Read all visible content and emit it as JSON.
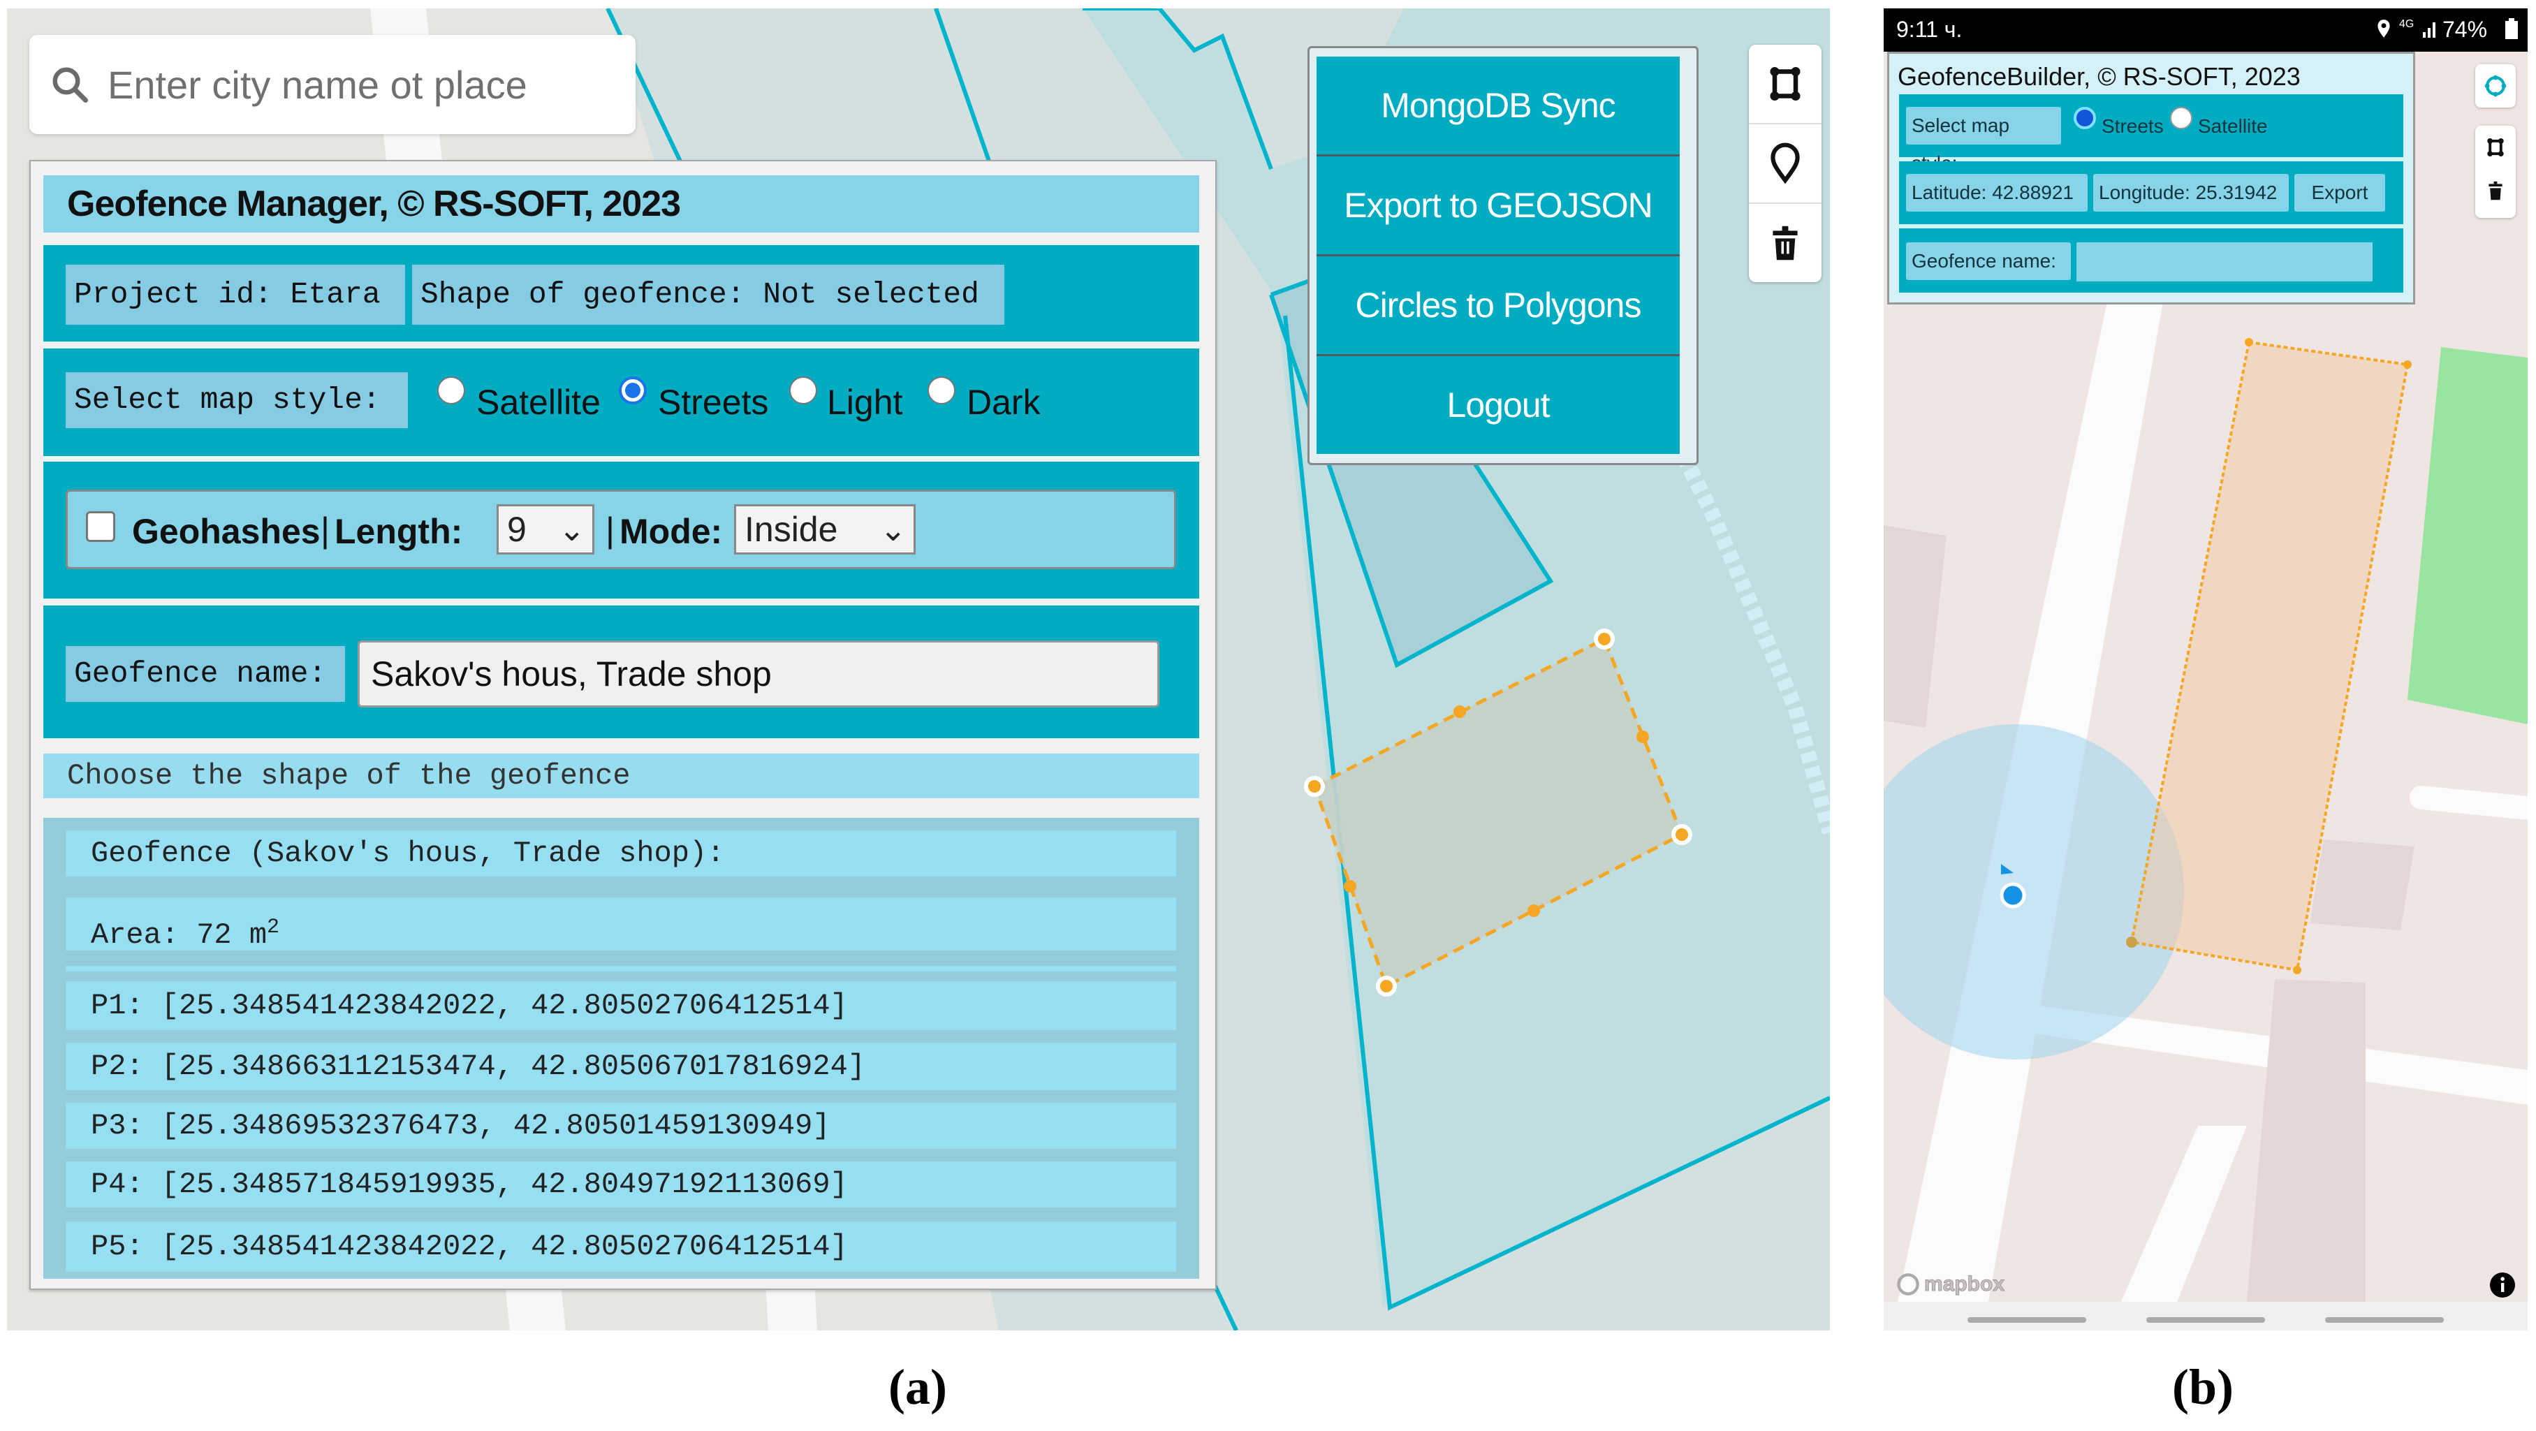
{
  "panel_a": {
    "search": {
      "placeholder": "Enter city name ot place",
      "icon": "search-icon"
    },
    "manager": {
      "title_prefix": "Geofence Manager, © ",
      "title_brand": "RS-SOFT, 2023",
      "project_label": "Project id: Etara",
      "shape_label": "Shape of geofence: Not selected",
      "map_style_label": "Select map style:",
      "map_styles": [
        {
          "label": "Satellite",
          "selected": false
        },
        {
          "label": "Streets",
          "selected": true
        },
        {
          "label": "Light",
          "selected": false
        },
        {
          "label": "Dark",
          "selected": false
        }
      ],
      "geohashes": {
        "checked": false,
        "label": "Geohashes",
        "sep1": "|",
        "length_label": "Length:",
        "length_value": "9",
        "sep2": "|",
        "mode_label": "Mode:",
        "mode_value": "Inside"
      },
      "geofence_name_label": "Geofence name:",
      "geofence_name_value": "Sakov's hous, Trade shop",
      "choose_shape_hint": "Choose the shape of the geofence",
      "result": {
        "heading": "Geofence (Sakov's hous, Trade shop):",
        "area_prefix": "Area: 72 m",
        "area_superscript": "2",
        "points": [
          "P1: [25.348541423842022, 42.80502706412514]",
          "P2: [25.348663112153474, 42.805067017816924]",
          "P3: [25.34869532376473, 42.80501459130949]",
          "P4: [25.348571845919935, 42.80497192113069]",
          "P5: [25.348541423842022, 42.80502706412514]"
        ]
      }
    },
    "menu": {
      "buttons": [
        "MongoDB Sync",
        "Export to GEOJSON",
        "Circles to Polygons",
        "Logout"
      ]
    },
    "draw_tools": [
      "polygon-tool-icon",
      "marker-tool-icon",
      "trash-icon"
    ],
    "colors": {
      "accent": "#00acc1",
      "label_bg": "#87d3e8",
      "geofence_stroke": "#f5a623"
    }
  },
  "panel_b": {
    "status_bar": {
      "time": "9:11 ч.",
      "network": "4G",
      "battery": "74%"
    },
    "app_title": "GeofenceBuilder, © RS-SOFT, 2023",
    "map_style_label": "Select map style:",
    "map_styles": [
      {
        "label": "Streets",
        "selected": true
      },
      {
        "label": "Satellite",
        "selected": false
      }
    ],
    "latitude_label": "Latitude: 42.88921",
    "longitude_label": "Longitude: 25.31942",
    "export_label": "Export",
    "geofence_name_label": "Geofence name:",
    "geofence_name_value": "",
    "map_attribution": "mapbox",
    "draw_tools": [
      "circle-tool-icon",
      "polygon-tool-icon",
      "trash-icon"
    ]
  },
  "captions": {
    "a": "(a)",
    "b": "(b)"
  }
}
